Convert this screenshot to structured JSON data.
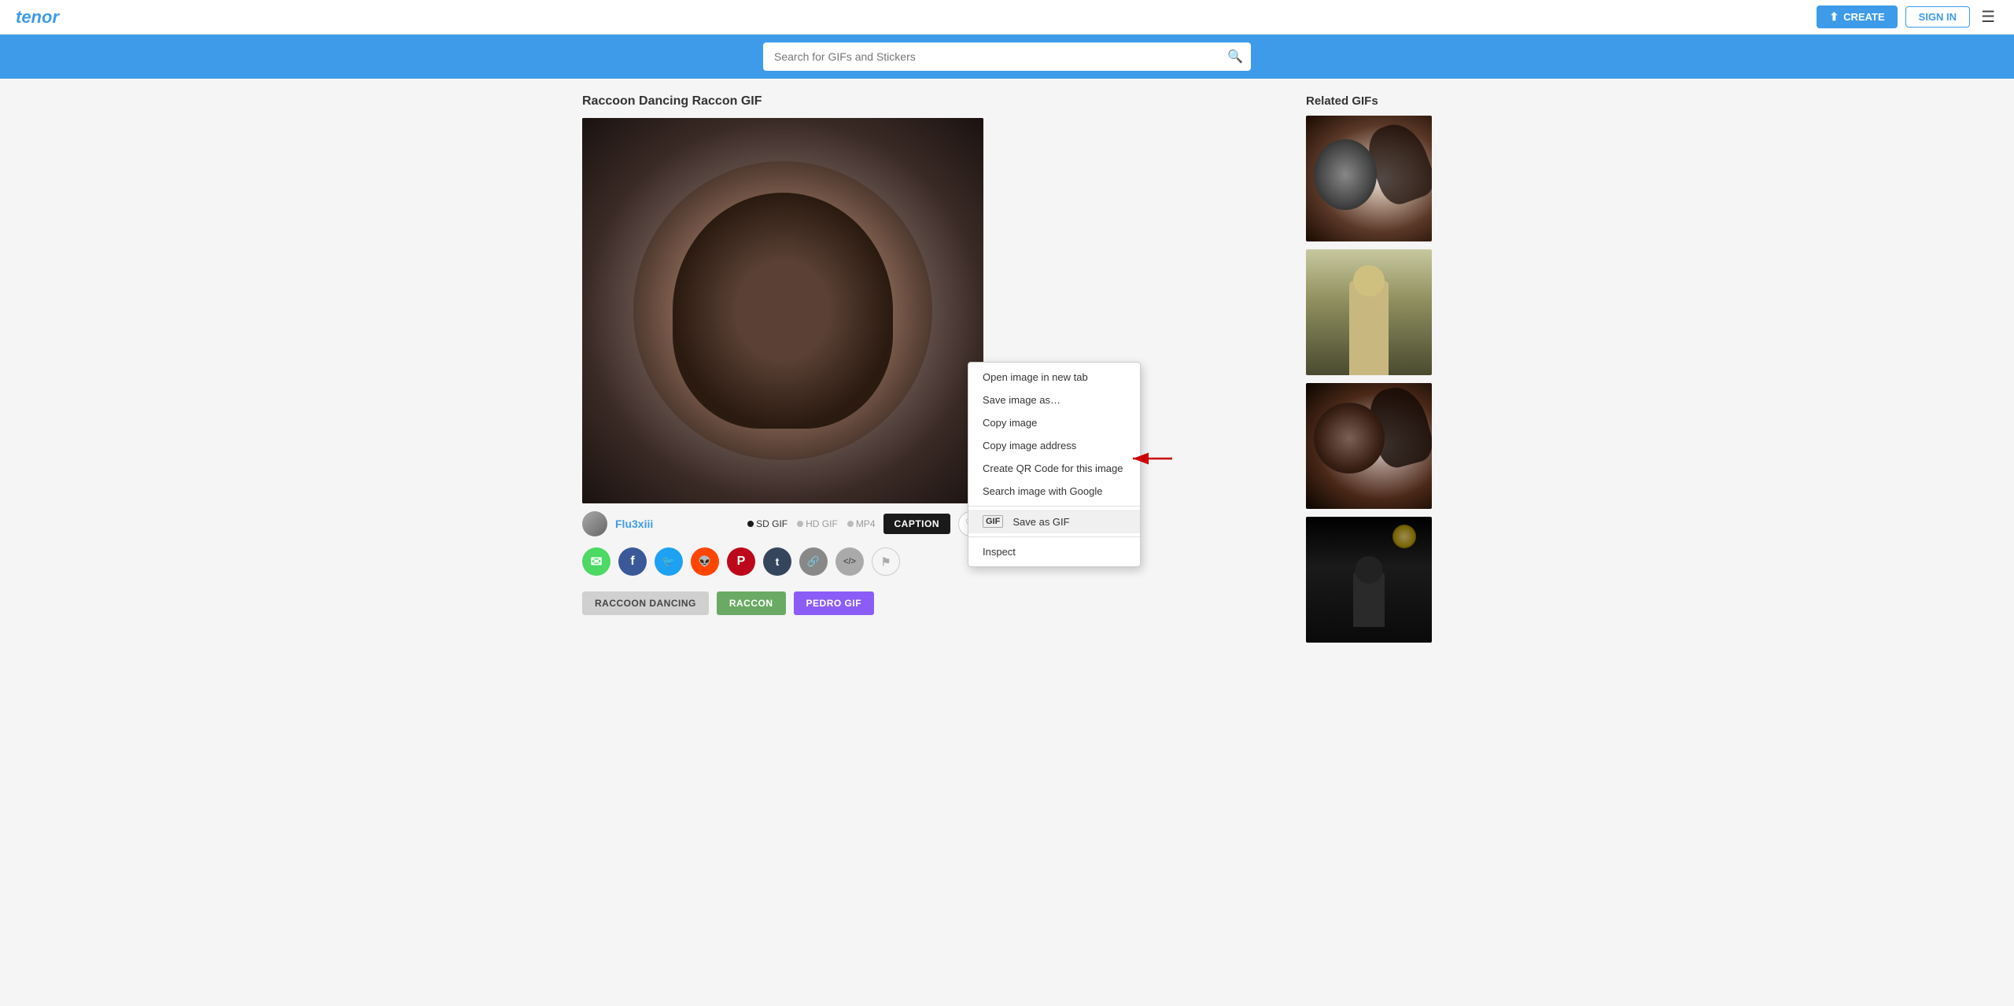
{
  "header": {
    "logo": "tenor",
    "create_label": "CREATE",
    "signin_label": "SIGN IN"
  },
  "search": {
    "placeholder": "Search for GIFs and Stickers"
  },
  "page": {
    "title": "Raccoon Dancing Raccon GIF"
  },
  "gif_info": {
    "username": "Flu3xiii",
    "format_sd": "SD GIF",
    "format_hd": "HD GIF",
    "format_mp4": "MP4",
    "caption_label": "CAPTION"
  },
  "context_menu": {
    "items": [
      {
        "label": "Open image in new tab",
        "icon": ""
      },
      {
        "label": "Save image as…",
        "icon": ""
      },
      {
        "label": "Copy image",
        "icon": ""
      },
      {
        "label": "Copy image address",
        "icon": ""
      },
      {
        "label": "Create QR Code for this image",
        "icon": ""
      },
      {
        "label": "Search image with Google",
        "icon": ""
      },
      {
        "label": "Save as GIF",
        "icon": "gif",
        "highlighted": true
      },
      {
        "label": "Inspect",
        "icon": ""
      }
    ]
  },
  "social": {
    "buttons": [
      {
        "name": "sms",
        "icon": "✉",
        "label": "SMS"
      },
      {
        "name": "facebook",
        "icon": "f",
        "label": "Facebook"
      },
      {
        "name": "twitter",
        "icon": "🐦",
        "label": "Twitter"
      },
      {
        "name": "reddit",
        "icon": "👽",
        "label": "Reddit"
      },
      {
        "name": "pinterest",
        "icon": "P",
        "label": "Pinterest"
      },
      {
        "name": "tumblr",
        "icon": "t",
        "label": "Tumblr"
      },
      {
        "name": "link",
        "icon": "🔗",
        "label": "Link"
      },
      {
        "name": "embed",
        "icon": "<>",
        "label": "Embed"
      },
      {
        "name": "flag",
        "icon": "⚑",
        "label": "Flag"
      }
    ]
  },
  "tags": [
    {
      "label": "RACCOON DANCING",
      "color": "default"
    },
    {
      "label": "RACCON",
      "color": "green"
    },
    {
      "label": "PEDRO GIF",
      "color": "purple"
    }
  ],
  "related": {
    "title": "Related GIFs"
  }
}
